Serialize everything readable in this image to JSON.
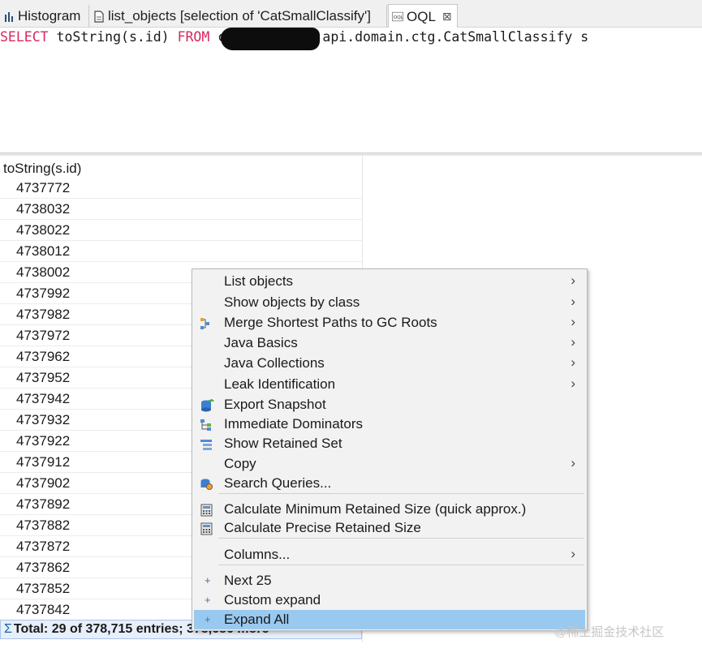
{
  "tabs": [
    {
      "label": "Histogram",
      "icon": "histogram-icon"
    },
    {
      "label": "list_objects  [selection of 'CatSmallClassify']",
      "icon": "document-icon"
    },
    {
      "label": "OQL",
      "icon": "oql-icon",
      "close": "⊠"
    }
  ],
  "query": {
    "kw_select": "SELECT",
    "expr": " toString(s.id) ",
    "kw_from": "FROM",
    "rest": " com.xxx.xxxx.api.domain.ctg.CatSmallClassify s"
  },
  "table": {
    "column_header": "toString(s.id)",
    "rows": [
      "4737772",
      "4738032",
      "4738022",
      "4738012",
      "4738002",
      "4737992",
      "4737982",
      "4737972",
      "4737962",
      "4737952",
      "4737942",
      "4737932",
      "4737922",
      "4737912",
      "4737902",
      "4737892",
      "4737882",
      "4737872",
      "4737862",
      "4737852",
      "4737842"
    ],
    "footer_icon": "Σ",
    "footer": "Total: 29 of 378,715 entries; 378,686 more"
  },
  "context_menu": {
    "items": [
      {
        "label": "List objects",
        "submenu": true
      },
      {
        "label": "Show objects by class",
        "submenu": true
      },
      {
        "label": "Merge Shortest Paths to GC Roots",
        "submenu": true,
        "icon": "merge-paths-icon"
      },
      {
        "label": "Java Basics",
        "submenu": true
      },
      {
        "label": "Java Collections",
        "submenu": true
      },
      {
        "label": "Leak Identification",
        "submenu": true
      },
      {
        "label": "Export Snapshot",
        "icon": "export-snapshot-icon"
      },
      {
        "label": "Immediate Dominators",
        "icon": "dominators-icon"
      },
      {
        "label": "Show Retained Set",
        "icon": "retained-set-icon"
      },
      {
        "label": "Copy",
        "submenu": true
      },
      {
        "label": "Search Queries...",
        "icon": "search-queries-icon"
      },
      {
        "label": "Calculate Minimum Retained Size (quick approx.)",
        "icon": "calculator-icon"
      },
      {
        "label": "Calculate Precise Retained Size",
        "icon": "calculator-icon"
      },
      {
        "label": "Columns...",
        "submenu": true
      },
      {
        "label": "Next 25",
        "icon": "plus-icon"
      },
      {
        "label": "Custom expand",
        "icon": "plus-icon"
      },
      {
        "label": "Expand All",
        "icon": "plus-icon",
        "highlighted": true
      }
    ],
    "arrow": "›",
    "plus": "+"
  },
  "watermark": "@稀土掘金技术社区",
  "colors": {
    "keyword": "#d6285e",
    "menu_highlight": "#99c9ef",
    "footer_bg": "#e6effa"
  }
}
